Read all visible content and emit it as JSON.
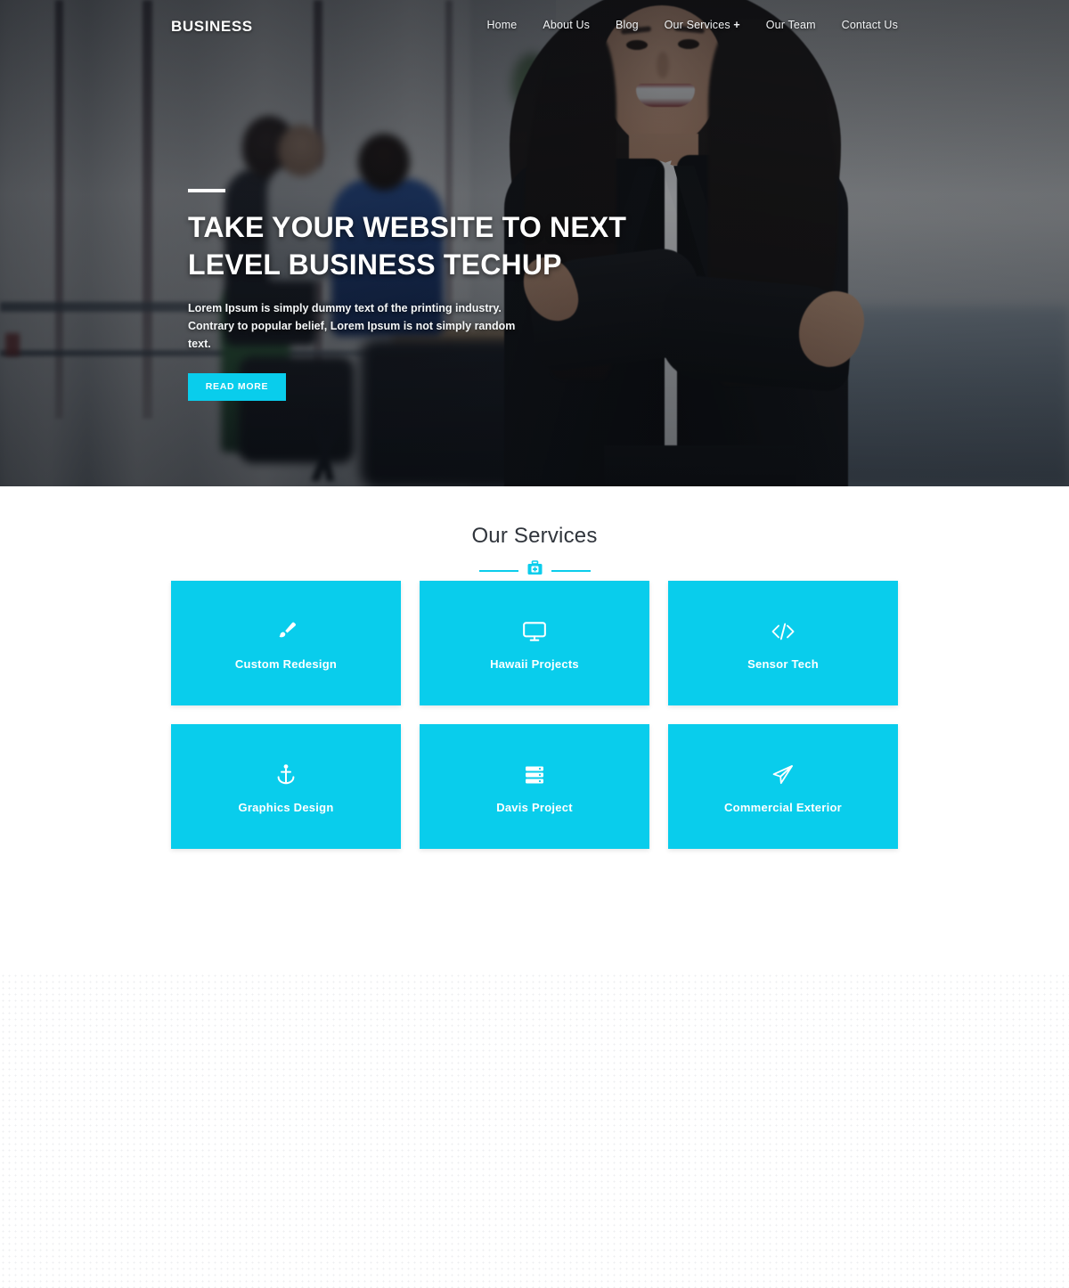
{
  "header": {
    "logo": "BUSINESS",
    "nav": [
      {
        "label": "Home",
        "icon": "",
        "has_caret": false
      },
      {
        "label": "About Us",
        "icon": "",
        "has_caret": false
      },
      {
        "label": "Blog",
        "icon": "",
        "has_caret": false
      },
      {
        "label": "Our Services",
        "icon": "plus-icon",
        "has_caret": true
      },
      {
        "label": "Our Team",
        "icon": "",
        "has_caret": false
      },
      {
        "label": "Contact Us",
        "icon": "",
        "has_caret": false
      }
    ]
  },
  "hero": {
    "title_line1": "TAKE YOUR WEBSITE TO NEXT",
    "title_line2": "LEVEL BUSINESS TECHUP",
    "subtitle": "Lorem Ipsum is simply dummy text of the printing industry. Contrary to popular belief, Lorem Ipsum is not simply random text.",
    "button_label": "READ MORE"
  },
  "services": {
    "heading": "Our Services",
    "divider_icon": "first-aid-kit-icon",
    "cards": [
      {
        "label": "Custom Redesign",
        "icon": "paint-brush-icon"
      },
      {
        "label": "Hawaii Projects",
        "icon": "desktop-monitor-icon"
      },
      {
        "label": "Sensor Tech",
        "icon": "code-brackets-icon"
      },
      {
        "label": "Graphics Design",
        "icon": "anchor-icon"
      },
      {
        "label": "Davis Project",
        "icon": "server-stack-icon"
      },
      {
        "label": "Commercial Exterior",
        "icon": "paper-plane-icon"
      }
    ]
  },
  "colors": {
    "accent": "#09cdec",
    "heading": "#30353c",
    "card_text": "#ffffff",
    "hero_text": "#ffffff"
  }
}
